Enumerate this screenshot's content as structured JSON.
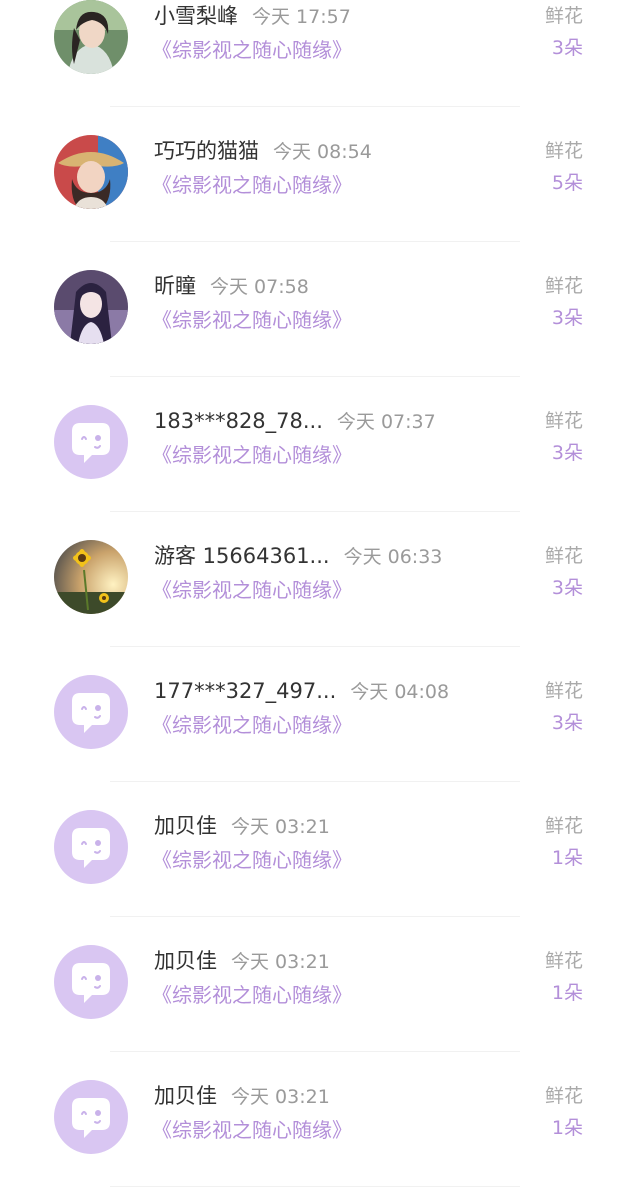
{
  "colors": {
    "accent": "#b38fd9",
    "default_avatar_bg": "#d9c6f2",
    "name": "#333333",
    "muted": "#9a9a9a"
  },
  "rows": [
    {
      "name": "小雪梨峰",
      "time": "今天 17:57",
      "work": "《综影视之随心随缘》",
      "gift_label": "鲜花",
      "gift_count": "3朵",
      "avatar": "photo-young-man-avatar"
    },
    {
      "name": "巧巧的猫猫",
      "time": "今天 08:54",
      "work": "《综影视之随心随缘》",
      "gift_label": "鲜花",
      "gift_count": "5朵",
      "avatar": "photo-woman-straw-hat-avatar"
    },
    {
      "name": "昕瞳",
      "time": "今天 07:58",
      "work": "《综影视之随心随缘》",
      "gift_label": "鲜花",
      "gift_count": "3朵",
      "avatar": "anime-girl-avatar"
    },
    {
      "name": "183***828_78...",
      "time": "今天 07:37",
      "work": "《综影视之随心随缘》",
      "gift_label": "鲜花",
      "gift_count": "3朵",
      "avatar": "default-chat-bubble-avatar"
    },
    {
      "name": "游客 15664361...",
      "time": "今天 06:33",
      "work": "《综影视之随心随缘》",
      "gift_label": "鲜花",
      "gift_count": "3朵",
      "avatar": "sunflower-avatar"
    },
    {
      "name": "177***327_497...",
      "time": "今天 04:08",
      "work": "《综影视之随心随缘》",
      "gift_label": "鲜花",
      "gift_count": "3朵",
      "avatar": "default-chat-bubble-avatar"
    },
    {
      "name": "加贝佳",
      "time": "今天 03:21",
      "work": "《综影视之随心随缘》",
      "gift_label": "鲜花",
      "gift_count": "1朵",
      "avatar": "default-chat-bubble-avatar"
    },
    {
      "name": "加贝佳",
      "time": "今天 03:21",
      "work": "《综影视之随心随缘》",
      "gift_label": "鲜花",
      "gift_count": "1朵",
      "avatar": "default-chat-bubble-avatar"
    },
    {
      "name": "加贝佳",
      "time": "今天 03:21",
      "work": "《综影视之随心随缘》",
      "gift_label": "鲜花",
      "gift_count": "1朵",
      "avatar": "default-chat-bubble-avatar"
    }
  ]
}
